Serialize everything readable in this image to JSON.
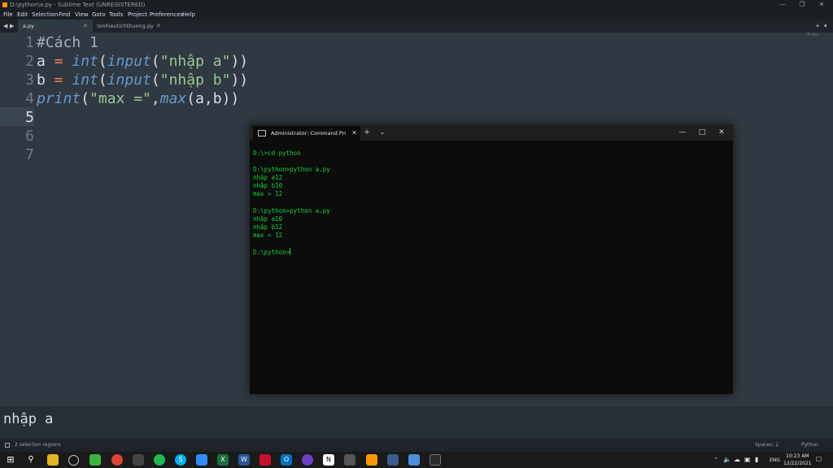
{
  "window": {
    "title": "D:\\python\\a.py - Sublime Text (UNREGISTERED)"
  },
  "menu": [
    "File",
    "Edit",
    "Selection",
    "Find",
    "View",
    "Goto",
    "Tools",
    "Project",
    "Preferences",
    "Help"
  ],
  "tabs": [
    {
      "label": "a.py",
      "active": true
    },
    {
      "label": "tonhieutichthuong.py",
      "active": false
    }
  ],
  "editor": {
    "lines": [
      "1",
      "2",
      "3",
      "4",
      "5",
      "6",
      "7"
    ],
    "current_line": 5,
    "line1": "#Cách 1",
    "line2": {
      "var": "a",
      "eq": " = ",
      "f1": "int",
      "p1": "(",
      "f2": "input",
      "p2": "(",
      "s": "\"nhập a\"",
      "p3": "))"
    },
    "line3": {
      "var": "b",
      "eq": " = ",
      "f1": "int",
      "p1": "(",
      "f2": "input",
      "p2": "(",
      "s": "\"nhập b\"",
      "p3": "))"
    },
    "line4": {
      "f1": "print",
      "p1": "(",
      "s": "\"max =\"",
      "p2": ",",
      "f2": "max",
      "p3": "(a,b))"
    }
  },
  "minimap_label": "Tiriệu",
  "console_output": "nhập a",
  "status": {
    "left": "2 selection regions",
    "spaces": "Spaces: 2",
    "syntax": "Python"
  },
  "terminal": {
    "tab_title": "Administrator: Command Prompt",
    "lines": [
      "D:\\>cd python",
      "",
      "D:\\python>python a.py",
      "nhập a12",
      "nhập b10",
      "max = 12",
      "",
      "D:\\python>python a.py",
      "nhập a10",
      "nhập b12",
      "max = 12",
      "",
      "D:\\python>"
    ]
  },
  "taskbar": {
    "lang": "ENG",
    "time": "10:23 AM",
    "date": "12/22/2021"
  },
  "colors": {
    "editor_bg": "#303841",
    "terminal_text": "#13d436",
    "string": "#99c794",
    "function": "#6699cc",
    "operator": "#f97b58"
  }
}
